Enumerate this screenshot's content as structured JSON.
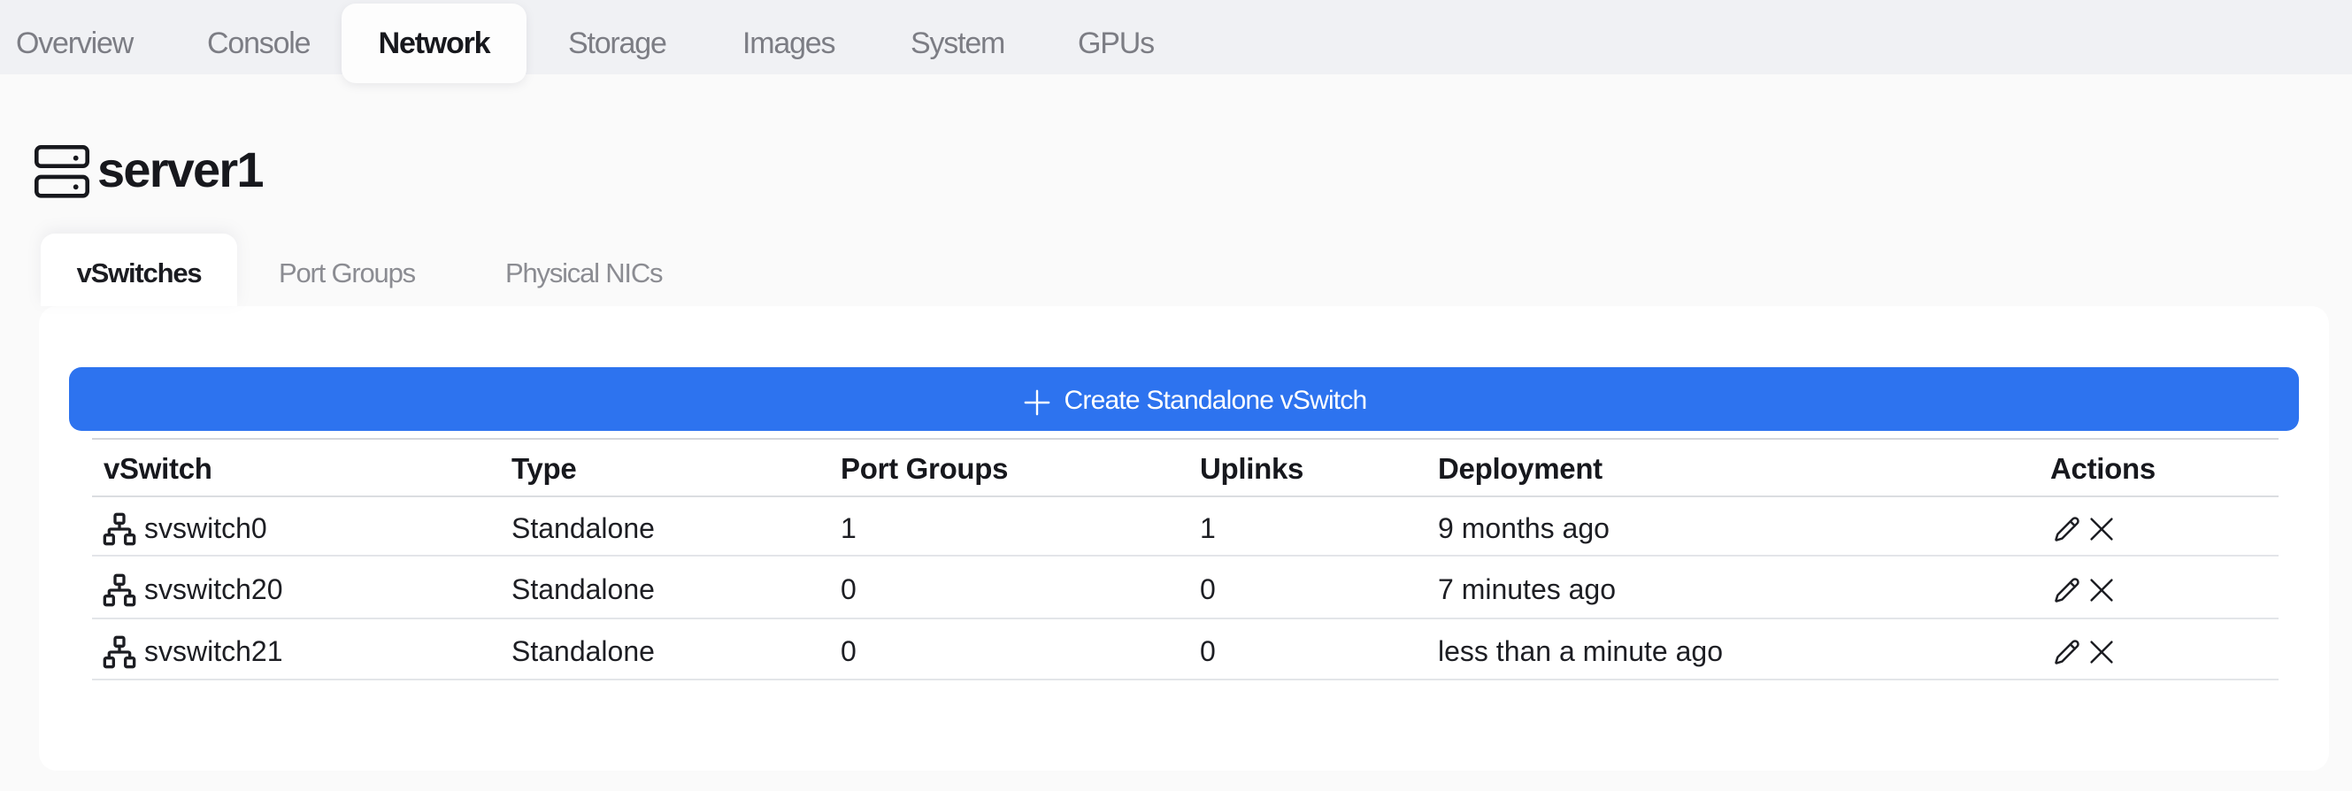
{
  "main_tabs": {
    "items": [
      {
        "label": "Overview",
        "active": false
      },
      {
        "label": "Console",
        "active": false
      },
      {
        "label": "Network",
        "active": true
      },
      {
        "label": "Storage",
        "active": false
      },
      {
        "label": "Images",
        "active": false
      },
      {
        "label": "System",
        "active": false
      },
      {
        "label": "GPUs",
        "active": false
      }
    ]
  },
  "page": {
    "title": "server1",
    "title_icon": "server-stack-icon"
  },
  "sub_tabs": {
    "items": [
      {
        "label": "vSwitches",
        "active": true
      },
      {
        "label": "Port Groups",
        "active": false
      },
      {
        "label": "Physical NICs",
        "active": false
      }
    ]
  },
  "toolbar": {
    "create_button_label": "Create Standalone vSwitch",
    "create_button_icon": "plus-icon"
  },
  "table": {
    "columns": [
      "vSwitch",
      "Type",
      "Port Groups",
      "Uplinks",
      "Deployment",
      "Actions"
    ],
    "rows": [
      {
        "name": "svswitch0",
        "type": "Standalone",
        "port_groups": "1",
        "uplinks": "1",
        "deployment": "9 months ago"
      },
      {
        "name": "svswitch20",
        "type": "Standalone",
        "port_groups": "0",
        "uplinks": "0",
        "deployment": "7 minutes ago"
      },
      {
        "name": "svswitch21",
        "type": "Standalone",
        "port_groups": "0",
        "uplinks": "0",
        "deployment": "less than a minute ago"
      }
    ],
    "row_icon": "network-icon",
    "action_icons": [
      "pencil-icon",
      "x-icon"
    ]
  },
  "colors": {
    "accent_blue": "#2d73ef",
    "topbar_bg": "#f0f1f4",
    "page_bg": "#fafafa",
    "card_bg": "#ffffff",
    "text_dark": "#17181d",
    "text_gray": "#7c7d84"
  }
}
